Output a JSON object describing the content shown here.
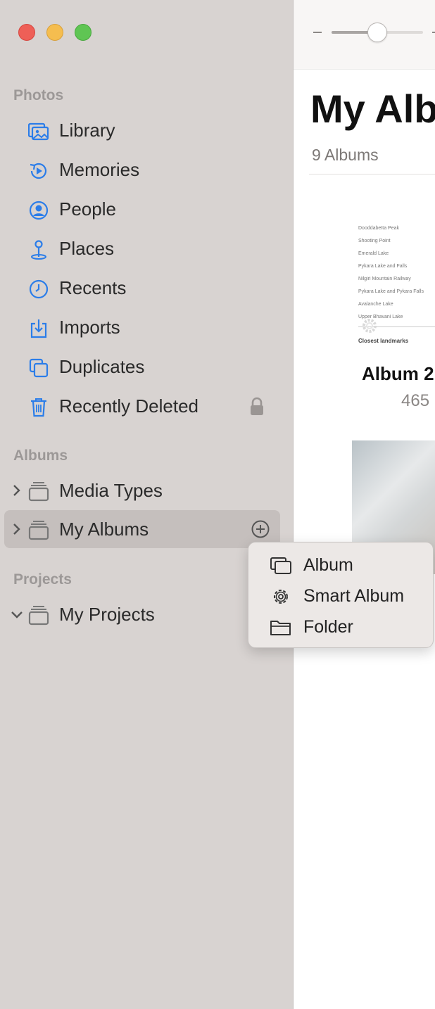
{
  "sidebar": {
    "sections": {
      "photos": "Photos",
      "albums": "Albums",
      "projects": "Projects"
    },
    "items": [
      {
        "label": "Library",
        "icon": "library-icon"
      },
      {
        "label": "Memories",
        "icon": "memories-icon"
      },
      {
        "label": "People",
        "icon": "people-icon"
      },
      {
        "label": "Places",
        "icon": "places-icon"
      },
      {
        "label": "Recents",
        "icon": "recents-icon"
      },
      {
        "label": "Imports",
        "icon": "imports-icon"
      },
      {
        "label": "Duplicates",
        "icon": "duplicates-icon"
      },
      {
        "label": "Recently Deleted",
        "icon": "trash-icon",
        "locked": true
      }
    ],
    "groups": [
      {
        "label": "Media Types",
        "expanded": false,
        "icon": "album-stack-icon"
      },
      {
        "label": "My Albums",
        "expanded": false,
        "selected": true,
        "icon": "album-stack-icon"
      },
      {
        "label": "My Projects",
        "expanded": true,
        "icon": "album-stack-icon"
      }
    ]
  },
  "main": {
    "title": "My Alb",
    "count": "9 Albums",
    "zoom_level": 0.5,
    "albums": [
      {
        "name": "Album 2",
        "items": "465",
        "thumbnail_lines": [
          "Dooddabetta Peak",
          "Shooting Point",
          "Emerald Lake",
          "Pykara Lake and Falls",
          "Nilgiri Mountain Railway",
          "Pykara Lake and Pykara Falls",
          "Avalanche Lake",
          "Upper Bhavani Lake"
        ],
        "thumbnail_footer": "Closest landmarks"
      }
    ]
  },
  "popup_menu": {
    "items": [
      {
        "label": "Album",
        "icon": "album-icon"
      },
      {
        "label": "Smart Album",
        "icon": "gear-icon"
      },
      {
        "label": "Folder",
        "icon": "folder-icon"
      }
    ]
  },
  "colors": {
    "accent": "#2b7de9",
    "sidebar_bg": "#d8d3d1",
    "selection": "#c5bfbd",
    "close": "#ee5f57",
    "minimize": "#f5bd4f",
    "zoom": "#5fc553"
  }
}
